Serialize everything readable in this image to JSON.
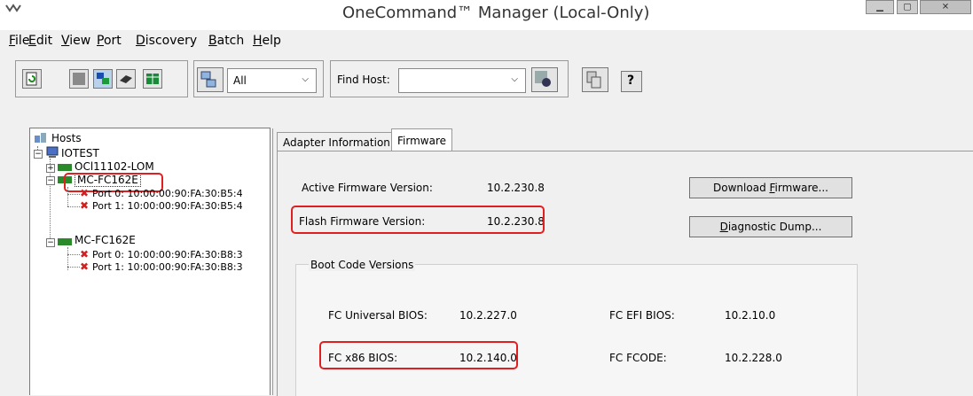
{
  "window": {
    "title": "OneCommand™ Manager (Local-Only)",
    "minimize_icon": "minimize-icon",
    "maximize_icon": "maximize-icon",
    "close_icon": "close-icon"
  },
  "menu": [
    {
      "mn": "F",
      "rest": "ile"
    },
    {
      "mn": "E",
      "rest": "dit"
    },
    {
      "mn": "V",
      "rest": "iew"
    },
    {
      "mn": "P",
      "rest": "ort"
    },
    {
      "mn": "D",
      "rest": "iscovery"
    },
    {
      "mn": "B",
      "rest": "atch"
    },
    {
      "mn": "H",
      "rest": "elp"
    }
  ],
  "toolbar": {
    "filter_value": "All",
    "find_host_label": "Find Host:",
    "find_host_value": "",
    "help_glyph": "?"
  },
  "tree": {
    "root": "Hosts",
    "host": "IOTEST",
    "adapters": [
      {
        "name": "OCl11102-LOM",
        "ports": []
      },
      {
        "name": "MC-FC162E",
        "ports": [
          "Port 0: 10:00:00:90:FA:30:B5:4",
          "Port 1: 10:00:00:90:FA:30:B5:4"
        ]
      },
      {
        "name": "MC-FC162E",
        "ports": [
          "Port 0: 10:00:00:90:FA:30:B8:3",
          "Port 1: 10:00:00:90:FA:30:B8:3"
        ]
      }
    ]
  },
  "tabs": [
    {
      "label": "Adapter Information",
      "active": false
    },
    {
      "label": "Firmware",
      "active": true
    }
  ],
  "firmware": {
    "active_label": "Active Firmware Version:",
    "active_value": "10.2.230.8",
    "flash_label": "Flash Firmware Version:",
    "flash_value": "10.2.230.8",
    "download_btn": {
      "pre": "Download ",
      "mn": "F",
      "post": "irmware..."
    },
    "diag_btn": {
      "pre": "",
      "mn": "D",
      "post": "iagnostic Dump..."
    },
    "boot_group_title": "Boot Code Versions",
    "fc_universal_label": "FC Universal BIOS:",
    "fc_universal_value": "10.2.227.0",
    "fc_efi_label": "FC EFI BIOS:",
    "fc_efi_value": "10.2.10.0",
    "fc_x86_label": "FC x86 BIOS:",
    "fc_x86_value": "10.2.140.0",
    "fc_fcode_label": "FC FCODE:",
    "fc_fcode_value": "10.2.228.0"
  },
  "colors": {
    "highlight": "#e02020",
    "selection": "#000000"
  }
}
